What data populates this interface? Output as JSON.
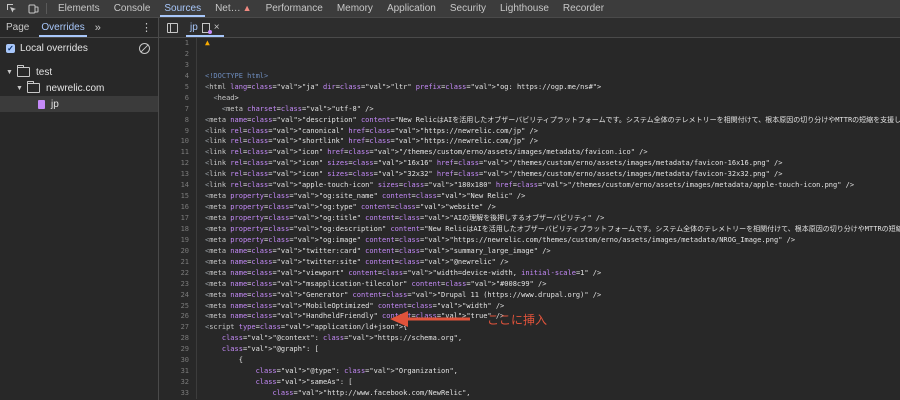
{
  "topbar": {
    "tabs": [
      {
        "label": "Elements"
      },
      {
        "label": "Console"
      },
      {
        "label": "Sources"
      },
      {
        "label": "Net…"
      },
      {
        "label": "Performance"
      },
      {
        "label": "Memory"
      },
      {
        "label": "Application"
      },
      {
        "label": "Security"
      },
      {
        "label": "Lighthouse"
      },
      {
        "label": "Recorder"
      }
    ]
  },
  "left_panel": {
    "tabs": [
      {
        "label": "Page"
      },
      {
        "label": "Overrides"
      }
    ],
    "more": "»",
    "local_overrides_label": "Local overrides",
    "tree": [
      {
        "label": "test"
      },
      {
        "label": "newrelic.com"
      },
      {
        "label": "jp"
      }
    ]
  },
  "editor": {
    "file_tab": "jp",
    "lines": [
      {
        "n": "1",
        "t": "",
        "warn": true
      },
      {
        "n": "2",
        "t": ""
      },
      {
        "n": "3",
        "t": ""
      },
      {
        "n": "4",
        "t": "<!DOCTYPE html>"
      },
      {
        "n": "5",
        "t": "<html lang=\"ja\" dir=\"ltr\" prefix=\"og: https://ogp.me/ns#\">"
      },
      {
        "n": "6",
        "t": "  <head>"
      },
      {
        "n": "7",
        "t": "    <meta charset=\"utf-8\" />"
      },
      {
        "n": "8",
        "t": "<meta name=\"description\" content=\"New RelicはAIを活用したオブザーバビリティプラットフォームです。システム全体のテレメトリーを相関付けて、根本原因の切り分けやMTTRの短縮を支援し..."
      },
      {
        "n": "9",
        "t": "<link rel=\"canonical\" href=\"https://newrelic.com/jp\" />"
      },
      {
        "n": "10",
        "t": "<link rel=\"shortlink\" href=\"https://newrelic.com/jp\" />"
      },
      {
        "n": "11",
        "t": "<link rel=\"icon\" href=\"/themes/custom/erno/assets/images/metadata/favicon.ico\" />"
      },
      {
        "n": "12",
        "t": "<link rel=\"icon\" sizes=\"16x16\" href=\"/themes/custom/erno/assets/images/metadata/favicon-16x16.png\" />"
      },
      {
        "n": "13",
        "t": "<link rel=\"icon\" sizes=\"32x32\" href=\"/themes/custom/erno/assets/images/metadata/favicon-32x32.png\" />"
      },
      {
        "n": "14",
        "t": "<link rel=\"apple-touch-icon\" sizes=\"180x180\" href=\"/themes/custom/erno/assets/images/metadata/apple-touch-icon.png\" />"
      },
      {
        "n": "15",
        "t": "<meta property=\"og:site_name\" content=\"New Relic\" />"
      },
      {
        "n": "16",
        "t": "<meta property=\"og:type\" content=\"website\" />"
      },
      {
        "n": "17",
        "t": "<meta property=\"og:title\" content=\"AIの理解を後押しするオブザーバビリティ\" />"
      },
      {
        "n": "18",
        "t": "<meta property=\"og:description\" content=\"New RelicはAIを活用したオブザーバビリティプラットフォームです。システム全体のテレメトリーを相関付けて、根本原因の切り分けやMTTRの短縮を..."
      },
      {
        "n": "19",
        "t": "<meta property=\"og:image\" content=\"https://newrelic.com/themes/custom/erno/assets/images/metadata/NROG_Image.png\" />"
      },
      {
        "n": "20",
        "t": "<meta name=\"twitter:card\" content=\"summary_large_image\" />"
      },
      {
        "n": "21",
        "t": "<meta name=\"twitter:site\" content=\"@newrelic\" />"
      },
      {
        "n": "22",
        "t": "<meta name=\"viewport\" content=\"width=device-width, initial-scale=1\" />"
      },
      {
        "n": "23",
        "t": "<meta name=\"msapplication-tilecolor\" content=\"#008c99\" />"
      },
      {
        "n": "24",
        "t": "<meta name=\"Generator\" content=\"Drupal 11 (https://www.drupal.org)\" />"
      },
      {
        "n": "25",
        "t": "<meta name=\"MobileOptimized\" content=\"width\" />"
      },
      {
        "n": "26",
        "t": "<meta name=\"HandheldFriendly\" content=\"true\" />"
      },
      {
        "n": "27",
        "t": "<script type=\"application/ld+json\">{"
      },
      {
        "n": "28",
        "t": "    \"@context\": \"https://schema.org\","
      },
      {
        "n": "29",
        "t": "    \"@graph\": ["
      },
      {
        "n": "30",
        "t": "        {"
      },
      {
        "n": "31",
        "t": "            \"@type\": \"Organization\","
      },
      {
        "n": "32",
        "t": "            \"sameAs\": ["
      },
      {
        "n": "33",
        "t": "                \"http://www.facebook.com/NewRelic\","
      }
    ]
  },
  "annotation": {
    "label": "ここに挿入",
    "color": "#e0533b"
  }
}
